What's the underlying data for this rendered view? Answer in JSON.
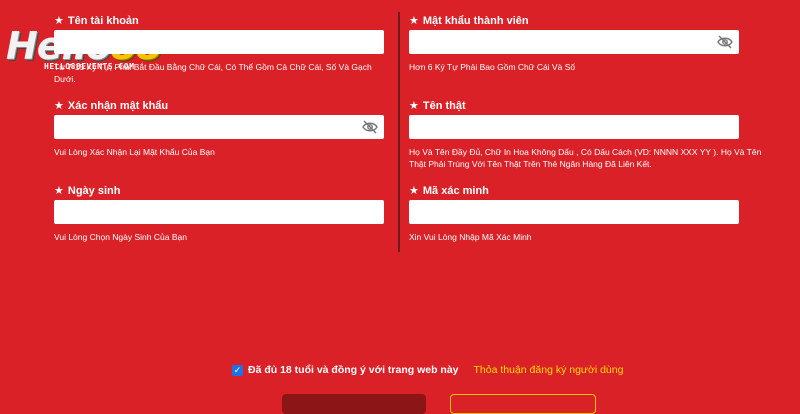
{
  "logo": {
    "text_main": "Hello",
    "text_accent": "88",
    "subtitle": "HELLO88EVENTS.COM"
  },
  "fields": {
    "username": {
      "label": "Tên tài khoản",
      "hint": "Từ 7-15 Ký Tự, Phải Bắt Đầu Bằng Chữ Cái, Có Thể Gồm Cả Chữ Cái, Số Và Gạch Dưới."
    },
    "password": {
      "label": "Mật khẩu thành viên",
      "hint": "Hơn 6 Ký Tự Phải Bao Gồm Chữ Cái Và Số"
    },
    "confirm_password": {
      "label": "Xác nhận mật khẩu",
      "hint": "Vui Lòng Xác Nhận Lại Mật Khẩu Của Bạn"
    },
    "real_name": {
      "label": "Tên thật",
      "hint": "Họ Và Tên Đầy Đủ, Chữ In Hoa Không Dấu , Có Dấu Cách (VD: NNNN XXX YY ). Họ Và Tên Thật Phải Trùng Với Tên Thật Trên Thẻ Ngân Hàng Đã Liên Kết."
    },
    "birthday": {
      "label": "Ngày sinh",
      "hint": "Vui Lòng Chọn Ngày Sinh Của Bạn"
    },
    "captcha": {
      "label": "Mã xác minh",
      "hint": "Xin Vui Lòng Nhập Mã Xác Minh"
    }
  },
  "agreement": {
    "text": "Đã đủ 18 tuổi và đồng ý với trang web này",
    "link": "Thỏa thuận đăng ký người dùng",
    "checked": true
  },
  "colors": {
    "background": "#da2128",
    "accent": "#ffde00",
    "checkbox": "#1a73e8"
  },
  "icons": {
    "label_marker": "star-icon",
    "password_toggle": "eye-off-icon"
  }
}
